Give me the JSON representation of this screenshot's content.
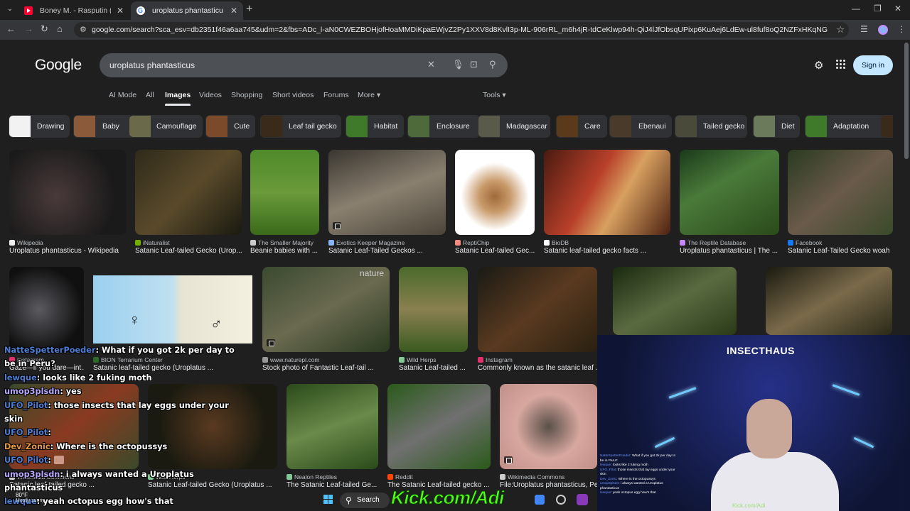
{
  "browser": {
    "tabs": [
      {
        "title": "Boney M. - Rasputin (Sopot Fe",
        "favicon": "youtube-icon"
      },
      {
        "title": "uroplatus phantasticus - Googl",
        "favicon": "google-icon",
        "active": true
      }
    ],
    "new_tab": "+",
    "url": "google.com/search?sca_esv=db2351f46a6aa745&udm=2&fbs=ADc_l-aN0CWEZBOHjofHoaMMDiKpaEWjvZ2Py1XXV8d8KvlI3p-ML-906rRL_m6h4jR-tdCeKlwp94h-QiJ4lJfObsqUPixp6KuAej6LdEw-ul8fuf8oQ2NZFxHKqNG3iSCyyh2JXI3Gn_k8SXL9Juh2B3YI..."
  },
  "google": {
    "logo": "Google",
    "query": "uroplatus phantasticus",
    "sign_in": "Sign in",
    "nav_tabs": [
      "AI Mode",
      "All",
      "Images",
      "Videos",
      "Shopping",
      "Short videos",
      "Forums",
      "More ▾",
      "Tools ▾"
    ],
    "active_tab": "Images",
    "chips": [
      "Drawing",
      "Baby",
      "Camouflage",
      "Cute",
      "Leaf tail gecko",
      "Habitat",
      "Enclosure",
      "Madagascar",
      "Care",
      "Ebenaui",
      "Tailed gecko",
      "Diet",
      "Adaptation"
    ],
    "row1": [
      {
        "source": "Wikipedia",
        "title": "Uroplatus phantasticus - Wikipedia"
      },
      {
        "source": "iNaturalist",
        "title": "Satanic Leaf-tailed Gecko (Urop..."
      },
      {
        "source": "The Smaller Majority",
        "title": "Beanie babies with ..."
      },
      {
        "source": "Exotics Keeper Magazine",
        "title": "Satanic Leaf-Tailed Geckos ..."
      },
      {
        "source": "ReptiChip",
        "title": "Satanic Leaf-tailed Gec..."
      },
      {
        "source": "BioDB",
        "title": "Satanic leaf-tailed gecko facts ..."
      },
      {
        "source": "The Reptile Database",
        "title": "Uroplatus phantasticus | The ..."
      },
      {
        "source": "Facebook",
        "title": "Satanic Leaf-Tailed Gecko woah"
      }
    ],
    "row2": [
      {
        "source": "Instagram",
        "title": "Gaze—if you dare—int..."
      },
      {
        "source": "BION Terrarium Center",
        "title": "Satanic leaf-tailed gecko (Uroplatus ..."
      },
      {
        "source": "www.naturepl.com",
        "title": "Stock photo of Fantastic Leaf-tail ..."
      },
      {
        "source": "Wild Herps",
        "title": "Satanic Leaf-tailed ..."
      },
      {
        "source": "Instagram",
        "title": "Commonly known as the satanic leaf ..."
      }
    ],
    "row3": [
      {
        "source": "Wikimedia Commons",
        "title": "Satanic leaf-tailed gecko ..."
      },
      {
        "source": "Wild Herps",
        "title": "Satanic Leaf-tailed Gecko (Uroplatus ..."
      },
      {
        "source": "Nealon Reptiles",
        "title": "The Satanic Leaf-tailed Ge..."
      },
      {
        "source": "Reddit",
        "title": "The Satanic Leaf-tailed gecko ..."
      },
      {
        "source": "Wikimedia Commons",
        "title": "File:Uroplatus phantasticus, Pey..."
      }
    ],
    "image_watermarks": [
      "nature",
      "♀",
      "♂"
    ]
  },
  "stream": {
    "chat": [
      {
        "user": "NatteSpetterPoeder",
        "msg": "What if you got 2k per day to be in Peru?",
        "color": "blue"
      },
      {
        "user": "lewque",
        "msg": "looks like 2 fuking moth",
        "color": "blue"
      },
      {
        "user": "umop3plsdn",
        "msg": "yes",
        "color": "purple"
      },
      {
        "user": "UFO_Pilot",
        "msg": "those insects that lay eggs under your skin",
        "color": "blue"
      },
      {
        "user": "UFO_Pilot",
        "msg": "",
        "color": "blue"
      },
      {
        "user": "Dev_Zonic",
        "msg": "Where is the octopussys",
        "color": "orange"
      },
      {
        "user": "UFO_Pilot",
        "msg": "",
        "color": "blue"
      },
      {
        "user": "umop3plsdn",
        "msg": "i always wanted a Uroplatus phantasticus",
        "color": "purple"
      },
      {
        "user": "lewque",
        "msg": "yeah octopus egg how's that",
        "color": "blue"
      }
    ],
    "cam_title": "INSECTHAUS",
    "cam_credit": "Kick.com/Adi",
    "kick_url": "Kick.com/Adi",
    "taskbar": {
      "search": "Search",
      "weather_temp": "80°F",
      "weather_desc": "Mostly sunny"
    }
  },
  "colors": {
    "accent": "#c2e7ff",
    "kick_green": "#53fc18",
    "page_bg": "#1f1f1f"
  }
}
